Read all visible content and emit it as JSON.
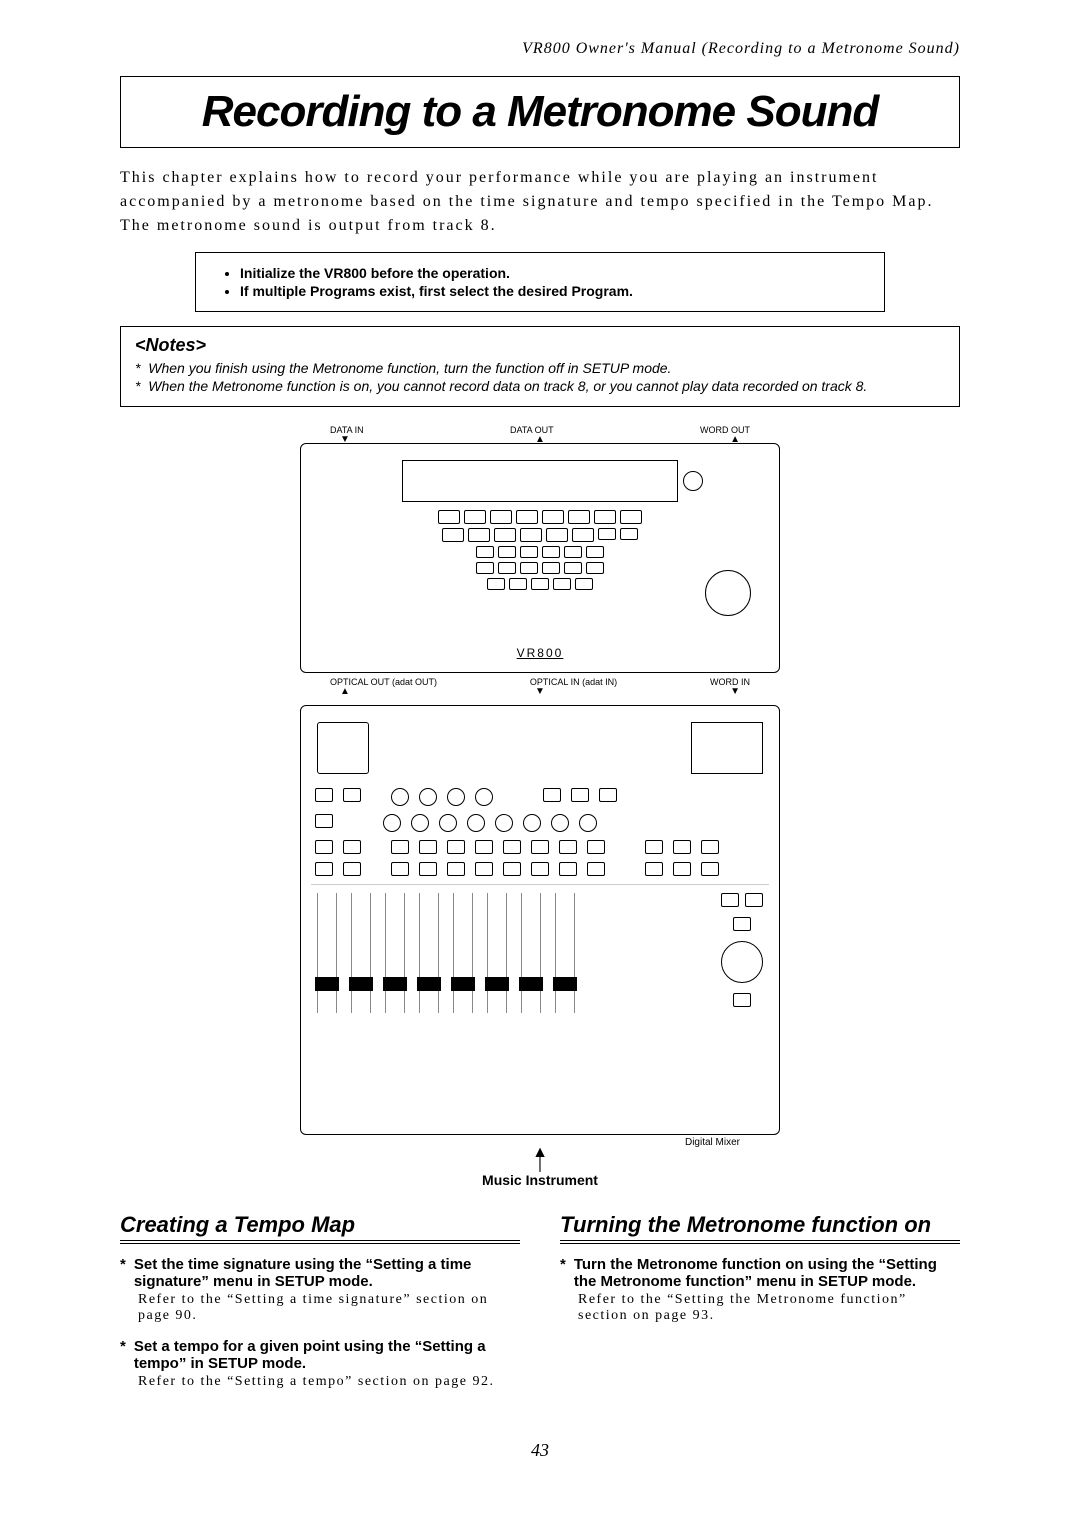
{
  "running_head": "VR800 Owner's Manual (Recording to a Metronome Sound)",
  "title": "Recording to a Metronome Sound",
  "intro": "This chapter explains how to record your performance while you are playing an instrument accompanied by a metronome based on the time signature and tempo specified in the Tempo Map. The metronome sound is output from track 8.",
  "init": {
    "items": [
      "Initialize the VR800 before the operation.",
      "If multiple Programs exist, first select the desired Program."
    ]
  },
  "notes": {
    "head": "<Notes>",
    "items": [
      "When you finish using the Metronome function, turn the function off in SETUP mode.",
      "When the Metronome function is on, you cannot record data on track 8, or you cannot play data recorded on track 8."
    ]
  },
  "diagram": {
    "top_ports": {
      "left": "DATA IN",
      "mid": "DATA OUT",
      "right": "WORD OUT"
    },
    "brand": "VR800",
    "mid_ports": {
      "left": "OPTICAL OUT (adat OUT)",
      "mid": "OPTICAL IN (adat IN)",
      "right": "WORD IN"
    },
    "mixer_label": "Digital Mixer",
    "instrument_label": "Music Instrument"
  },
  "left_section": {
    "head": "Creating a Tempo Map",
    "steps": [
      {
        "head": "Set the time signature using the “Setting a time signature” menu in SETUP mode.",
        "body": "Refer to the “Setting a time signature” section on page 90."
      },
      {
        "head": "Set a tempo for a given point using the “Setting a tempo” in SETUP mode.",
        "body": "Refer to the “Setting a tempo” section on page 92."
      }
    ]
  },
  "right_section": {
    "head": "Turning the Metronome function on",
    "steps": [
      {
        "head": "Turn the Metronome function on using the “Setting the Metronome function” menu in SETUP mode.",
        "body": "Refer to the “Setting the Metronome function” section on page 93."
      }
    ]
  },
  "page_number": "43"
}
